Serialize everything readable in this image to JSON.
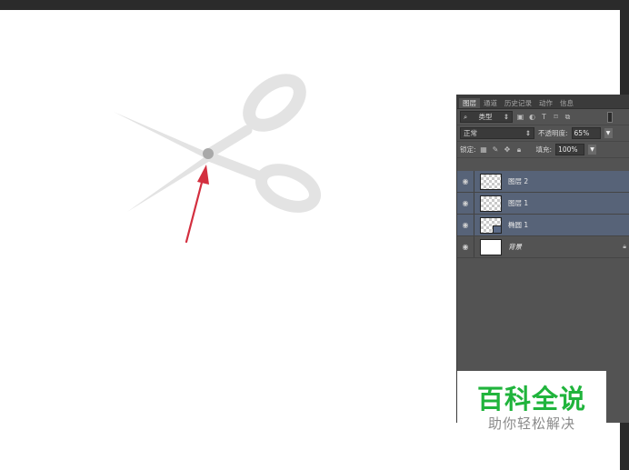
{
  "layers_panel": {
    "tabs": [
      {
        "label": "图层",
        "active": true
      },
      {
        "label": "通道"
      },
      {
        "label": "历史记录"
      },
      {
        "label": "动作"
      },
      {
        "label": "信息"
      }
    ],
    "filter": {
      "label": "类型",
      "search_icon": "search-icon"
    },
    "blend_mode": "正常",
    "opacity_label": "不透明度:",
    "opacity_value": "65%",
    "lock_label": "锁定:",
    "fill_label": "填充:",
    "fill_value": "100%",
    "layers": [
      {
        "name": "图层 2",
        "selected": true,
        "thumb": "transparent"
      },
      {
        "name": "图层 1",
        "selected": true,
        "thumb": "transparent"
      },
      {
        "name": "椭圆 1",
        "selected": true,
        "thumb": "shape"
      },
      {
        "name": "背景",
        "selected": false,
        "thumb": "white",
        "locked": true
      }
    ]
  },
  "watermark": {
    "title": "百科全说",
    "subtitle": "助你轻松解决"
  },
  "colors": {
    "panel_bg": "#535353",
    "selected_layer": "#576378",
    "arrow": "#d32f3f",
    "watermark_green": "#20b43c"
  }
}
